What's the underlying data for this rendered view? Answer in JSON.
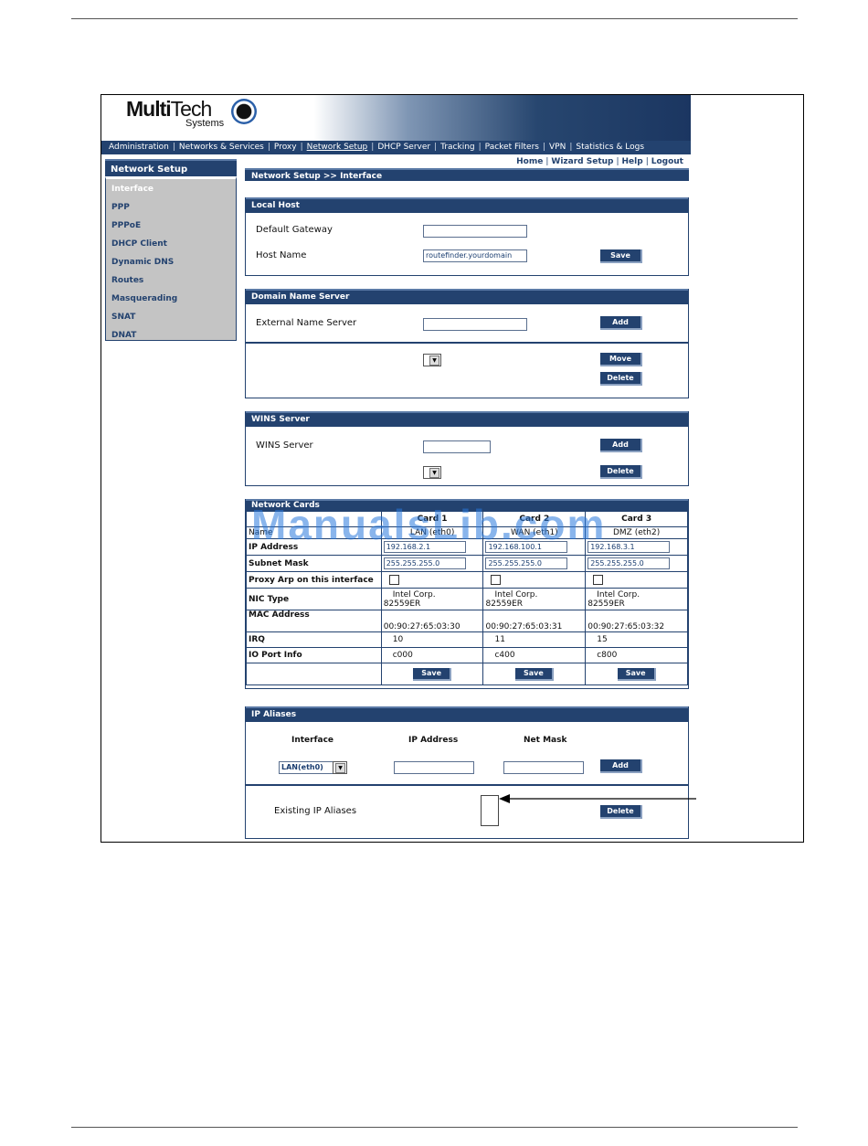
{
  "logo": {
    "brand_bold": "Multi",
    "brand_light": "Tech",
    "subtitle": "Systems"
  },
  "nav": [
    "Administration",
    "Networks & Services",
    "Proxy",
    "Network Setup",
    "DHCP Server",
    "Tracking",
    "Packet Filters",
    "VPN",
    "Statistics & Logs"
  ],
  "nav_active_index": 3,
  "toplinks": [
    "Home",
    "Wizard Setup",
    "Help",
    "Logout"
  ],
  "sidebar": {
    "title": "Network Setup",
    "items": [
      "Interface",
      "PPP",
      "PPPoE",
      "DHCP Client",
      "Dynamic DNS",
      "Routes",
      "Masquerading",
      "SNAT",
      "DNAT"
    ]
  },
  "breadcrumb": "Network Setup >> Interface",
  "local_host": {
    "title": "Local Host",
    "gateway_label": "Default Gateway",
    "gateway_value": "",
    "hostname_label": "Host Name",
    "hostname_value": "routefinder.yourdomain",
    "save": "Save"
  },
  "dns": {
    "title": "Domain Name Server",
    "external_label": "External Name Server",
    "external_value": "",
    "add": "Add",
    "move": "Move",
    "delete": "Delete"
  },
  "wins": {
    "title": "WINS Server",
    "label": "WINS Server",
    "value": "",
    "add": "Add",
    "delete": "Delete"
  },
  "network_cards": {
    "title": "Network Cards",
    "name_label": "Name",
    "cards": [
      {
        "header": "Card 1",
        "name": "LAN (eth0)",
        "ip": "192.168.2.1",
        "mask": "255.255.255.0",
        "nic1": "Intel Corp.",
        "nic2": "82559ER",
        "mac": "00:90:27:65:03:30",
        "irq": "10",
        "io": "c000"
      },
      {
        "header": "Card 2",
        "name": "WAN (eth1)",
        "ip": "192.168.100.1",
        "mask": "255.255.255.0",
        "nic1": "Intel Corp.",
        "nic2": "82559ER",
        "mac": "00:90:27:65:03:31",
        "irq": "11",
        "io": "c400"
      },
      {
        "header": "Card 3",
        "name": "DMZ (eth2)",
        "ip": "192.168.3.1",
        "mask": "255.255.255.0",
        "nic1": "Intel Corp.",
        "nic2": "82559ER",
        "mac": "00:90:27:65:03:32",
        "irq": "15",
        "io": "c800"
      }
    ],
    "rows": {
      "ip": "IP Address",
      "mask": "Subnet Mask",
      "proxy_arp": "Proxy Arp on this interface",
      "nic": "NIC Type",
      "mac": "MAC Address",
      "irq": "IRQ",
      "io": "IO Port Info"
    },
    "save": "Save"
  },
  "ip_aliases": {
    "title": "IP Aliases",
    "col_interface": "Interface",
    "col_ip": "IP Address",
    "col_mask": "Net Mask",
    "interface_value": "LAN(eth0)",
    "add": "Add",
    "existing_label": "Existing IP Aliases",
    "delete": "Delete"
  },
  "watermark": "ManualsLib.com"
}
